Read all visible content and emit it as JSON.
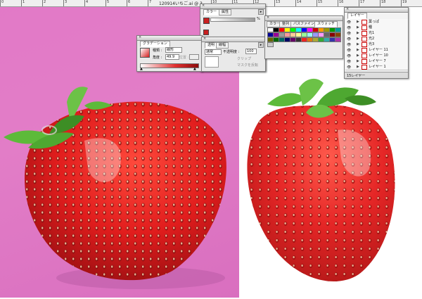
{
  "window": {
    "title": "120914いちご.ai @ 3"
  },
  "ruler": {
    "labels": [
      "0",
      "1",
      "2",
      "3",
      "4",
      "5",
      "6",
      "7",
      "8",
      "9",
      "10",
      "11",
      "12",
      "13",
      "14",
      "15",
      "16",
      "17",
      "18",
      "19",
      "20"
    ]
  },
  "panels": {
    "color": {
      "tabs": [
        "カラー",
        "属性"
      ],
      "percent_label": "%",
      "menu_icon": "menu-triangle-icon"
    },
    "gradient": {
      "tab": "グラデーション",
      "type_label": "種類 :",
      "type_value": "線形",
      "angle_label": "角度 :",
      "angle_value": "49.9",
      "location_label": "位置 :"
    },
    "transparency": {
      "tabs": [
        "透明",
        "線幅"
      ],
      "mode_value": "通常",
      "opacity_label": "不透明度 :",
      "opacity_value": "100",
      "clip_label": "クリップ",
      "mask_label": "マスクを反転"
    },
    "swatches": {
      "tabs": [
        "カラー",
        "整列",
        "パスファインダ",
        "スウォッチ"
      ]
    },
    "layers": {
      "tab": "レイヤー",
      "rows": [
        {
          "name": "葉っぱ"
        },
        {
          "name": "種"
        },
        {
          "name": "光1"
        },
        {
          "name": "光2"
        },
        {
          "name": "光3"
        },
        {
          "name": "レイヤー 11"
        },
        {
          "name": "レイヤー 10"
        },
        {
          "name": "レイヤー 7"
        },
        {
          "name": "レイヤー 1"
        }
      ],
      "footer": "15レイヤー"
    }
  },
  "colors": {
    "pink": "#e279c7",
    "berry": "#e12a2a",
    "berry_dark": "#b31818",
    "leaf": "#5dba3a",
    "leaf_dark": "#3d8e25"
  }
}
